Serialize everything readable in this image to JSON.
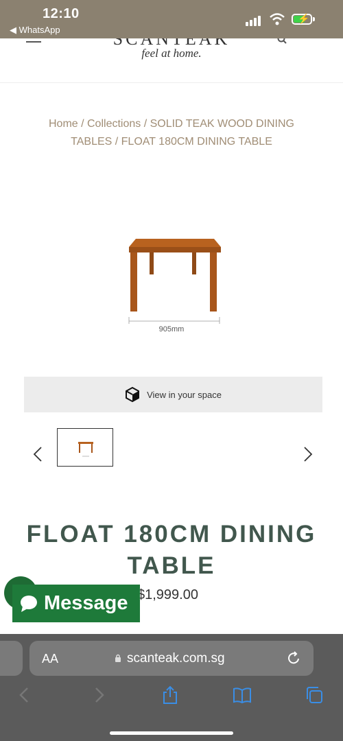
{
  "status_bar": {
    "time": "12:10",
    "back_app": "◀ WhatsApp"
  },
  "header": {
    "brand": "SCANTEAK",
    "tagline": "feel at home."
  },
  "breadcrumb": "Home / Collections / SOLID TEAK WOOD DINING TABLES / FLOAT 180CM DINING TABLE",
  "product": {
    "dimension_label": "905mm",
    "ar_button_label": "View in your space",
    "title": "FLOAT 180CM DINING TABLE",
    "price": "$1,999.00"
  },
  "message_button": {
    "label": "Message"
  },
  "browser": {
    "text_size_label": "AA",
    "url": "scanteak.com.sg"
  },
  "colors": {
    "title": "#41574d",
    "breadcrumb": "#a08d75",
    "message": "#1e7a3a",
    "ios_link": "#3a8ee6"
  }
}
